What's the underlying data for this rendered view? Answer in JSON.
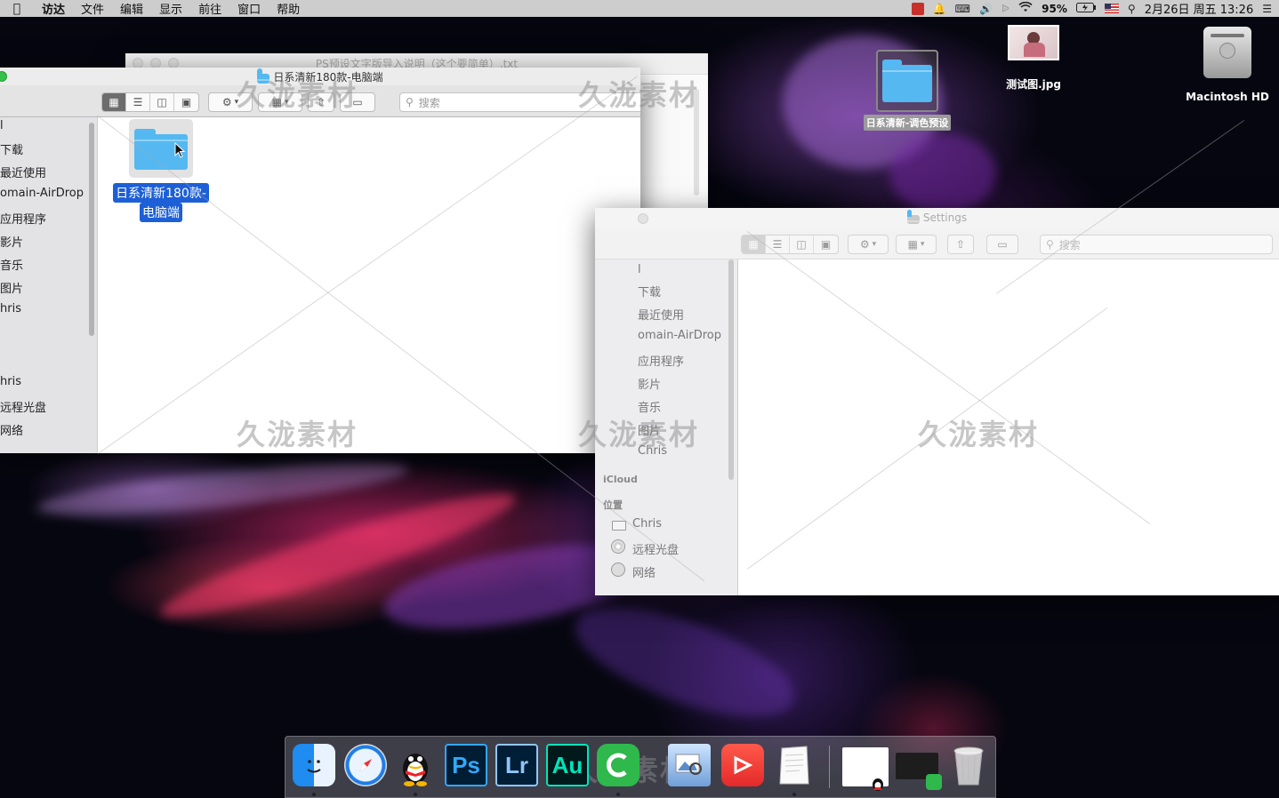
{
  "menubar": {
    "app_name": "访达",
    "items": [
      "文件",
      "编辑",
      "显示",
      "前往",
      "窗口",
      "帮助"
    ],
    "battery": "95%",
    "datetime": "2月26日 周五 13:26"
  },
  "desktop": {
    "folder_label": "日系清新-调色预设",
    "image_label": "测试图.jpg",
    "drive_label": "Macintosh HD"
  },
  "background_window": {
    "title": "PS预设文字版导入说明（这个要简单）.txt"
  },
  "finder_front": {
    "title": "日系清新180款-电脑端",
    "search_placeholder": "搜索",
    "sidebar_items": [
      "l",
      "下载",
      "最近使用",
      "omain-AirDrop",
      "应用程序",
      "影片",
      "音乐",
      "图片",
      "hris",
      "hris",
      "远程光盘",
      "网络"
    ],
    "selected_item_label_line1": "日系清新180款-",
    "selected_item_label_line2": "电脑端"
  },
  "finder_settings": {
    "title": "Settings",
    "search_placeholder": "搜索",
    "sidebar_items": [
      "l",
      "下载",
      "最近使用",
      "omain-AirDrop",
      "应用程序",
      "影片",
      "音乐",
      "图片",
      "Chris"
    ],
    "section_icloud": "iCloud",
    "section_location": "位置",
    "location_items": [
      "Chris",
      "远程光盘",
      "网络"
    ]
  },
  "watermark": {
    "text": "久泷素材"
  },
  "dock": {
    "apps": [
      "finder-icon",
      "safari-icon",
      "qq-icon",
      "photoshop-icon",
      "lightroom-icon",
      "audition-icon",
      "camtasia-icon",
      "preview-icon",
      "screen-recorder-icon",
      "textedit-icon",
      "document-thumbnail",
      "camtasia-recording",
      "trash-icon"
    ],
    "ps_label": "Ps",
    "lr_label": "Lr",
    "au_label": "Au"
  },
  "colors": {
    "folder_blue": "#55b8f0",
    "selection_blue": "#1d5fd6",
    "ps_bg": "#001d34",
    "ps_fg": "#31a8ff",
    "lr_bg": "#001e36",
    "lr_fg": "#8fc6ff",
    "au_bg": "#00191a",
    "au_fg": "#00e4bb"
  }
}
